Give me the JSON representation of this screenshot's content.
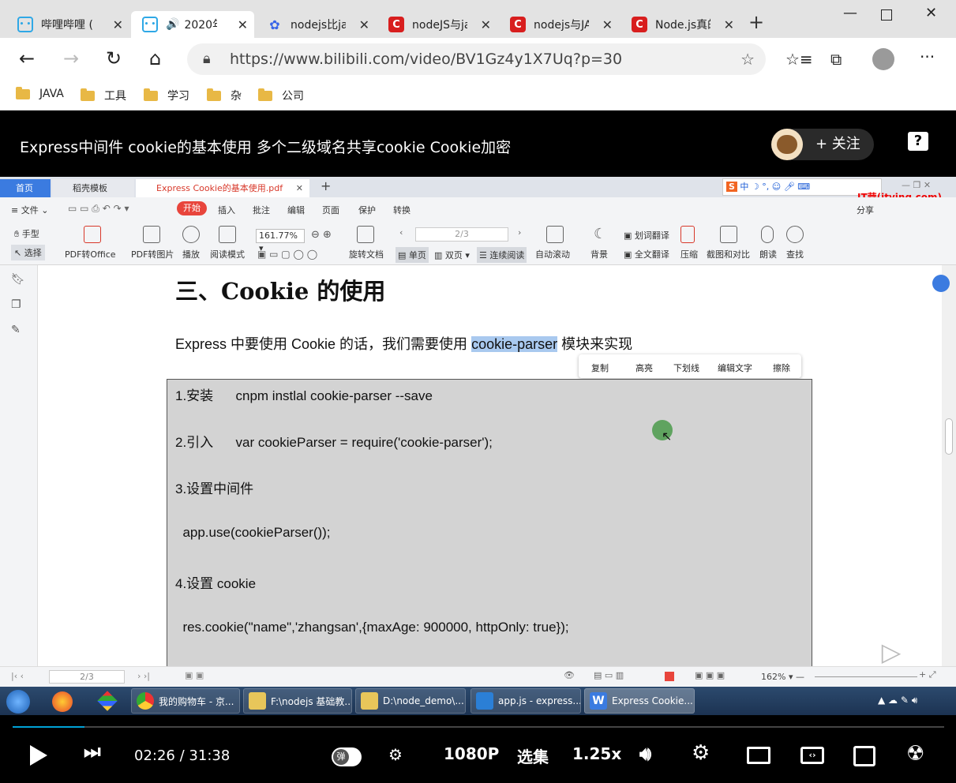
{
  "browser": {
    "tabs": [
      {
        "title": "哔哩哔哩 (",
        "close": "✕",
        "color": "#2fa8e6"
      },
      {
        "title": "2020年",
        "close": "✕",
        "color": "#2fa8e6",
        "audio": "🔊"
      },
      {
        "title": "nodejs比ja",
        "close": "✕",
        "color": "#3864e8"
      },
      {
        "title": "nodeJS与ja",
        "close": "✕",
        "color": "#d81e1e"
      },
      {
        "title": "nodejs与JA",
        "close": "✕",
        "color": "#d81e1e"
      },
      {
        "title": "Node.js真的",
        "close": "✕",
        "color": "#d81e1e"
      }
    ],
    "newtab": "+",
    "url": "https://www.bilibili.com/video/BV1Gz4y1X7Uq?p=30",
    "bookmarks": [
      "JAVA",
      "工具",
      "学习",
      "杂",
      "公司"
    ]
  },
  "video": {
    "title": "Express中间件 cookie的基本使用 多个二级域名共享cookie Cookie加密",
    "follow": "+ 关注",
    "help": "?"
  },
  "wps": {
    "tabs": [
      "首页",
      "稻壳模板",
      "Express Cookie的基本使用.pdf"
    ],
    "menu": [
      "文件",
      "开始",
      "插入",
      "批注",
      "编辑",
      "页面",
      "保护",
      "转换"
    ],
    "menu_active": "开始",
    "watermark": "IT营(itying.com)",
    "tools": [
      "手型",
      "选择",
      "PDF转Office",
      "PDF转图片",
      "播放",
      "阅读模式",
      "旋转文档",
      "单页",
      "双页",
      "连续阅读",
      "自动滚动",
      "背景",
      "划词翻译",
      "全文翻译",
      "压缩",
      "截图和对比",
      "朗读",
      "查找"
    ],
    "share": "分享",
    "zoom": "161.77%",
    "page": "2/3"
  },
  "doc": {
    "heading": "三、Cookie 的使用",
    "para_before": "Express 中要使用 Cookie 的话，我们需要使用 ",
    "para_highlight": "cookie-parser",
    "para_after": " 模块来实现",
    "popup": [
      "复制",
      "高亮",
      "下划线",
      "编辑文字",
      "擦除"
    ],
    "code": [
      "1.安装      cnpm instlal cookie-parser --save",
      "2.引入      var cookieParser = require('cookie-parser');",
      "3.设置中间件",
      "  app.use(cookieParser());",
      "4.设置 cookie",
      "  res.cookie(\"name\",'zhangsan',{maxAge: 900000, httpOnly: true});"
    ]
  },
  "status": {
    "page": "2/3",
    "zoom": "162%"
  },
  "taskbar": [
    "我的购物车 - 京...",
    "F:\\nodejs 基础教...",
    "D:\\node_demo\\...",
    "app.js - express...",
    "Express Cookie..."
  ],
  "player": {
    "time_current": "02:26",
    "time_sep": "/",
    "time_total": "31:38",
    "danmaku": "弹",
    "quality": "1080P",
    "episodes": "选集",
    "speed": "1.25x",
    "progress": 0.077
  }
}
